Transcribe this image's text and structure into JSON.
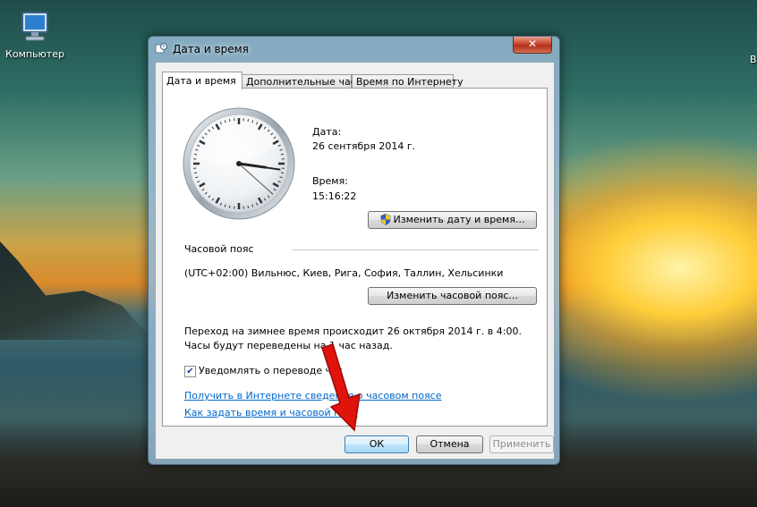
{
  "desktop": {
    "icons": [
      {
        "label": "Компьютер",
        "icon": "computer-icon"
      }
    ],
    "edge_label": "В"
  },
  "window": {
    "title": "Дата и время",
    "close_glyph": "✕",
    "tabs": [
      {
        "label": "Дата и время",
        "active": true
      },
      {
        "label": "Дополнительные часы",
        "active": false
      },
      {
        "label": "Время по Интернету",
        "active": false
      }
    ],
    "clock": {
      "hour": 15,
      "minute": 16,
      "second": 22
    },
    "date_label": "Дата:",
    "date_value": "26 сентября 2014 г.",
    "time_label": "Время:",
    "time_value": "15:16:22",
    "change_date_button": "Изменить дату и время...",
    "timezone_section": "Часовой пояс",
    "timezone_value": "(UTC+02:00) Вильнюс, Киев, Рига, София, Таллин, Хельсинки",
    "change_timezone_button": "Изменить часовой пояс...",
    "dst_notice": "Переход на зимнее время происходит 26 октября 2014 г. в 4:00. Часы будут переведены на 1 час назад.",
    "notify_checkbox": {
      "label": "Уведомлять о переводе час",
      "checked": true,
      "glyph": "✔"
    },
    "links": {
      "online": "Получить в Интернете сведения о часовом поясе",
      "howto": "Как задать время и часовой пояс"
    },
    "buttons": {
      "ok": "ОК",
      "cancel": "Отмена",
      "apply": "Применить"
    }
  },
  "colors": {
    "link": "#0066cc",
    "annotation_arrow": "#e0140c",
    "close_button": "#c9452c"
  }
}
